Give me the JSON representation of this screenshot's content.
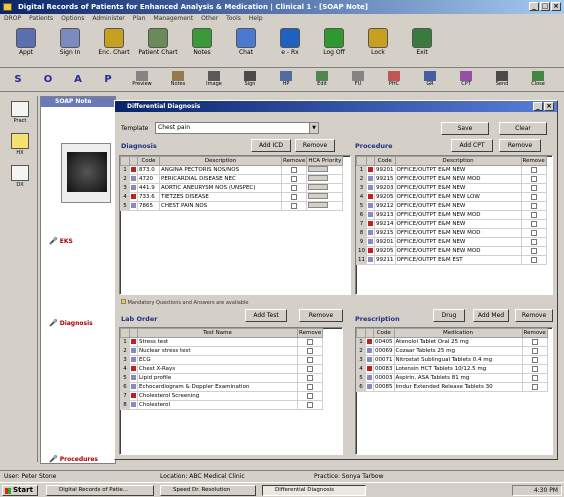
{
  "window": {
    "title": "Digital Records of Patients for Enhanced Analysis & Medication | Clinical 1 - [SOAP Note]"
  },
  "menu": [
    "DROP",
    "Patients",
    "Options",
    "Administer",
    "Plan",
    "Management",
    "Other",
    "Tools",
    "Help"
  ],
  "toolbar": [
    {
      "label": "Appt",
      "icon": "appointment-icon",
      "color": "#5a6fb0"
    },
    {
      "label": "Sign In",
      "icon": "sign-in-icon",
      "color": "#7b8bc0"
    },
    {
      "label": "Enc. Chart",
      "icon": "encounter-chart-icon",
      "color": "#c8a020"
    },
    {
      "label": "Patient Chart",
      "icon": "patient-chart-icon",
      "color": "#6a8a5a"
    },
    {
      "label": "Notes",
      "icon": "notes-icon",
      "color": "#3a9a3a"
    },
    {
      "label": "Chat",
      "icon": "chat-icon",
      "color": "#4a7ad0"
    },
    {
      "label": "e - Rx",
      "icon": "erx-icon",
      "color": "#2060c0"
    },
    {
      "label": "Log Off",
      "icon": "log-off-icon",
      "color": "#2e9a2e"
    },
    {
      "label": "Lock",
      "icon": "lock-icon",
      "color": "#c8a020"
    },
    {
      "label": "Exit",
      "icon": "exit-icon",
      "color": "#3a7a3a"
    }
  ],
  "soap_bar": [
    "S",
    "O",
    "A",
    "P"
  ],
  "toolbar2": [
    {
      "label": "Preview",
      "icon": "preview-icon"
    },
    {
      "label": "Notes",
      "icon": "notes-icon"
    },
    {
      "label": "Image",
      "icon": "image-icon"
    },
    {
      "label": "Sign",
      "icon": "sign-icon"
    },
    {
      "label": "HP",
      "icon": "hp-icon"
    },
    {
      "label": "Edit",
      "icon": "edit-icon"
    },
    {
      "label": "FU",
      "icon": "fu-icon"
    },
    {
      "label": "PHC",
      "icon": "phc-icon"
    },
    {
      "label": "GR",
      "icon": "gr-icon"
    },
    {
      "label": "CPT",
      "icon": "cpt-icon"
    },
    {
      "label": "Send",
      "icon": "send-icon"
    },
    {
      "label": "Close",
      "icon": "close-icon"
    }
  ],
  "leftbar": [
    {
      "label": "Pract",
      "icon": "practice-icon"
    },
    {
      "label": "HX",
      "icon": "history-icon"
    },
    {
      "label": "DX",
      "icon": "diagnosis-icon"
    }
  ],
  "soap": {
    "title": "SOAP Note",
    "mic_labels": [
      "EKS",
      "Diagnosis",
      "Procedures"
    ]
  },
  "dialog": {
    "title": "Differential Diagnosis",
    "template_label": "Template",
    "template_value": "Chest pain",
    "save": "Save",
    "clear": "Clear",
    "diagnosis": {
      "label": "Diagnosis",
      "add": "Add ICD",
      "remove": "Remove",
      "headers": [
        "",
        "",
        "Code",
        "Description",
        "Remove",
        "HCA Priority"
      ],
      "rows": [
        [
          "1",
          "873.0",
          "ANGINA PECTORIS NOS/NOS"
        ],
        [
          "2",
          "4720",
          "PERICARDIAL DISEASE NEC"
        ],
        [
          "3",
          "441.9",
          "AORTIC ANEURYSM NOS (UNSPEC)"
        ],
        [
          "4",
          "733.6",
          "TIETZES DISEASE"
        ],
        [
          "5",
          "7865",
          "CHEST PAIN NOS"
        ]
      ]
    },
    "procedure": {
      "label": "Procedure",
      "add": "Add CPT",
      "remove": "Remove",
      "headers": [
        "",
        "",
        "Code",
        "Description",
        "Remove"
      ],
      "rows": [
        [
          "1",
          "99201",
          "OFFICE/OUTPT E&M NEW"
        ],
        [
          "2",
          "99215",
          "OFFICE/OUTPT E&M NEW MOD"
        ],
        [
          "3",
          "99203",
          "OFFICE/OUTPT E&M NEW"
        ],
        [
          "4",
          "99205",
          "OFFICE/OUTPT E&M NEW LOW"
        ],
        [
          "5",
          "99212",
          "OFFICE/OUTPT E&M NEW"
        ],
        [
          "6",
          "99213",
          "OFFICE/OUTPT E&M NEW MOD"
        ],
        [
          "7",
          "99214",
          "OFFICE/OUTPT E&M NEW"
        ],
        [
          "8",
          "99215",
          "OFFICE/OUTPT E&M NEW MOD"
        ],
        [
          "9",
          "99201",
          "OFFICE/OUTPT E&M NEW"
        ],
        [
          "10",
          "99205",
          "OFFICE/OUTPT E&M NEW MOD"
        ],
        [
          "11",
          "99211",
          "OFFICE/OUTPT E&M EST"
        ]
      ]
    },
    "mandatory_note": "Mandatory Questions and Answers are available",
    "lab": {
      "label": "Lab Order",
      "add": "Add Test",
      "remove": "Remove",
      "headers": [
        "",
        "",
        "Test Name",
        "Remove"
      ],
      "rows": [
        [
          "1",
          "Stress test"
        ],
        [
          "2",
          "Nuclear stress test"
        ],
        [
          "3",
          "ECG"
        ],
        [
          "4",
          "Chest X-Rays"
        ],
        [
          "5",
          "Lipid profile"
        ],
        [
          "6",
          "Echocardiogram & Doppler Examination"
        ],
        [
          "7",
          "Cholesterol Screening"
        ],
        [
          "8",
          "Cholesterol"
        ]
      ]
    },
    "prescription": {
      "label": "Prescription",
      "drug": "Drug",
      "add": "Add Med",
      "remove": "Remove",
      "headers": [
        "",
        "",
        "Code",
        "Medication",
        "Remove"
      ],
      "rows": [
        [
          "1",
          "00405",
          "Atenolol Tablet Oral 25 mg"
        ],
        [
          "2",
          "00069",
          "Cozaar Tablets 25 mg"
        ],
        [
          "3",
          "00071",
          "Nitrostat Sublingual Tablets 0.4 mg"
        ],
        [
          "4",
          "00083",
          "Lotensin HCT Tablets 10/12.5 mg"
        ],
        [
          "5",
          "00003",
          "Aspirin, ASA Tablets 81 mg"
        ],
        [
          "6",
          "00085",
          "Imdur Extended Release Tablets 30"
        ]
      ]
    }
  },
  "status": {
    "user": "User: Peter Stone",
    "location": "Location: ABC Medical Clinic",
    "practice": "Practice: Sonya Tarbow"
  },
  "taskbar": {
    "start": "Start",
    "items": [
      "Digital Records of Patie...",
      "Speed Dr. Resolution",
      "Differential Diagnosis"
    ],
    "clock": "4:30 PM"
  }
}
